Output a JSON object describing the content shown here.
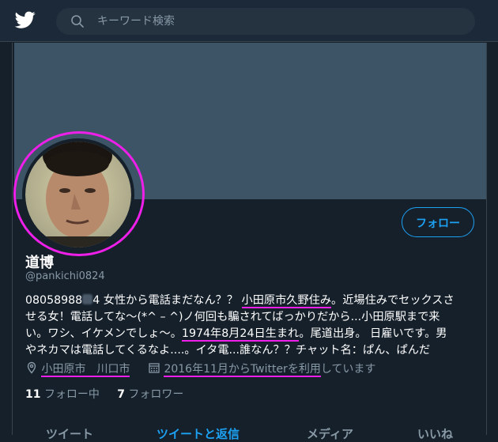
{
  "header": {
    "search_placeholder": "キーワード検索"
  },
  "profile": {
    "name": "道博",
    "handle": "@pankichi0824",
    "follow_label": "フォロー",
    "bio": {
      "l1_a": "08058988",
      "l1_b": "4 女性から電話まだなん？？ ",
      "l1_c": "小田原市久野住み",
      "l1_d": "。近場住みでセックスさ",
      "l2_a": "せる女！電話してな〜(*^ – ^)ノ何回も騙されてばっかりだから...小田原駅まで来",
      "l3_a": "い。ワシ、イケメンでしょ〜。",
      "l3_b": "1974年8月24日生まれ",
      "l3_c": "。尾道出身。 日雇いです。男",
      "l4_a": "やネカマは電話してくるなよ....。イタ電...誰なん？？チャット名：ぱん、ぱんだ"
    },
    "location": "小田原市　川口市",
    "joined_a": "2016年11月からTwitterを利用",
    "joined_b": "しています",
    "following_count": "11",
    "following_label": "フォロー中",
    "followers_count": "7",
    "followers_label": "フォロワー"
  },
  "tabs": {
    "tweets": "ツイート",
    "replies": "ツイートと返信",
    "media": "メディア",
    "likes": "いいね"
  },
  "colors": {
    "background": "#15202b",
    "accent": "#1da1f2",
    "highlight": "#ee1fe8",
    "muted": "#8899a6"
  }
}
